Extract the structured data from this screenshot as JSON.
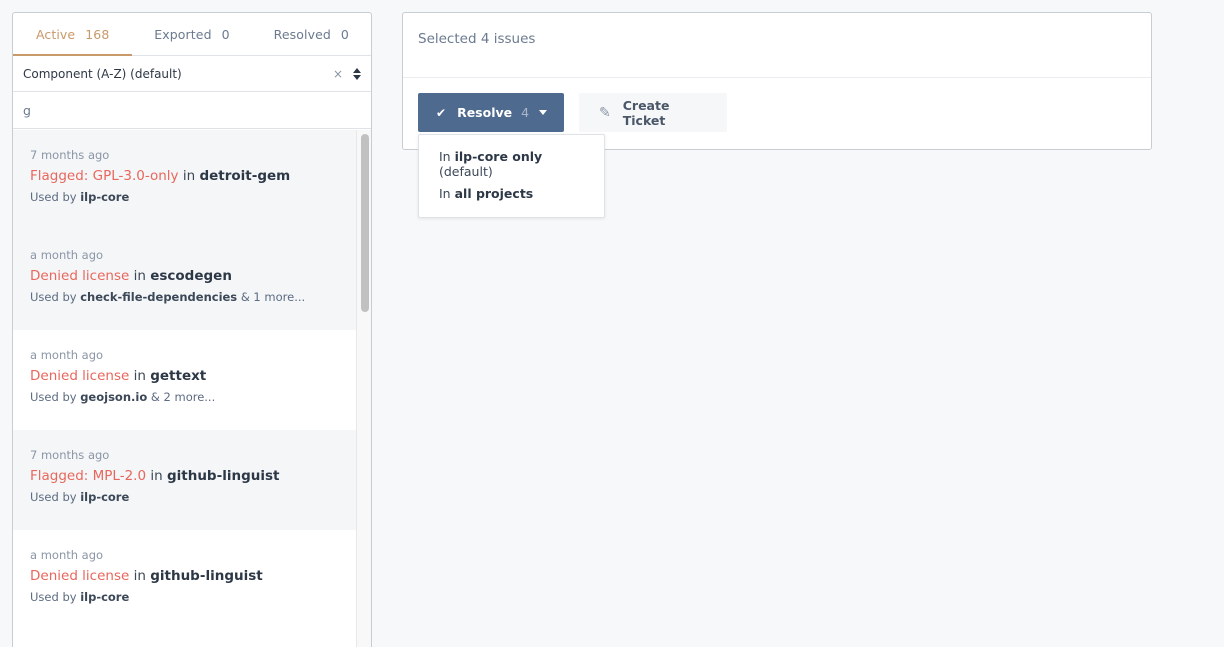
{
  "tabs": [
    {
      "label": "Active",
      "count": "168",
      "active": true
    },
    {
      "label": "Exported",
      "count": "0",
      "active": false
    },
    {
      "label": "Resolved",
      "count": "0",
      "active": false
    }
  ],
  "sort": {
    "label": "Component (A-Z) (default)",
    "clear_glyph": "×"
  },
  "search": {
    "value": "g"
  },
  "issues": [
    {
      "time": "7 months ago",
      "flag": "Flagged: GPL-3.0-only",
      "in": "in",
      "package": "detroit-gem",
      "used_by_prefix": "Used by",
      "project": "ilp-core",
      "more": "",
      "selected": true
    },
    {
      "time": "a month ago",
      "flag": "Denied license",
      "in": "in",
      "package": "escodegen",
      "used_by_prefix": "Used by",
      "project": "check-file-dependencies",
      "more": "& 1 more...",
      "selected": true
    },
    {
      "time": "a month ago",
      "flag": "Denied license",
      "in": "in",
      "package": "gettext",
      "used_by_prefix": "Used by",
      "project": "geojson.io",
      "more": "& 2 more...",
      "selected": false
    },
    {
      "time": "7 months ago",
      "flag": "Flagged: MPL-2.0",
      "in": "in",
      "package": "github-linguist",
      "used_by_prefix": "Used by",
      "project": "ilp-core",
      "more": "",
      "selected": true
    },
    {
      "time": "a month ago",
      "flag": "Denied license",
      "in": "in",
      "package": "github-linguist",
      "used_by_prefix": "Used by",
      "project": "ilp-core",
      "more": "",
      "selected": false
    }
  ],
  "selection": {
    "summary": "Selected 4 issues"
  },
  "actions": {
    "resolve_label": "Resolve",
    "resolve_count": "4",
    "create_ticket_label": "Create Ticket"
  },
  "resolve_menu": [
    {
      "prefix": "In",
      "bold": "ilp-core only",
      "suffix": "(default)"
    },
    {
      "prefix": "In",
      "bold": "all projects",
      "suffix": ""
    }
  ],
  "colors": {
    "accent": "#c8996a",
    "flag": "#e8675c",
    "primary_button": "#4f6a8f"
  }
}
